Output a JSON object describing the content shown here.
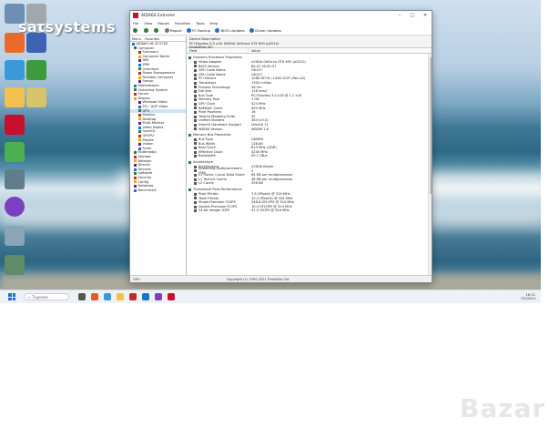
{
  "watermark": "satsystems",
  "bazar_logo": "Bazar",
  "window": {
    "title": "AIDA64 Extreme",
    "menu": [
      "File",
      "View",
      "Report",
      "Favorites",
      "Tools",
      "Help"
    ],
    "toolbar": [
      "Report",
      "PC Backup",
      "BIOS Updates",
      "Driver Updates"
    ],
    "left_tabs": [
      "Menu",
      "Favorites"
    ],
    "tree": [
      "AIDA64 v6.32.5700",
      "Computer",
      "Summary",
      "Computer Name",
      "DMI",
      "IPMI",
      "Overclock",
      "Power Management",
      "Portable Computer",
      "Sensor",
      "Motherboard",
      "Operating System",
      "Server",
      "Display",
      "Windows Video",
      "PCI / AGP Video",
      "GPU",
      "Monitor",
      "Desktop",
      "Multi-Monitor",
      "Video Modes",
      "OpenGL",
      "GPGPU",
      "Mantle",
      "Vulkan",
      "Fonts",
      "Multimedia",
      "Storage",
      "Network",
      "DirectX",
      "Devices",
      "Software",
      "Security",
      "Config",
      "Database",
      "Benchmark"
    ],
    "desc": {
      "label": "Device Description",
      "device": "PCI Express 3.0 x16: NVIDIA GeForce GTX 650 (p2010)",
      "extra": "NvidiaBios SEI"
    },
    "columns": {
      "field": "Field",
      "value": "Value"
    },
    "groups": [
      {
        "name": "Graphics Processor Properties",
        "rows": [
          [
            "Video Adapter",
            "nVIDIA GeForce GTX 650 (p2010)"
          ],
          [
            "BIOS Version",
            "80.07.35.00.57"
          ],
          [
            "GPU Code Name",
            "GK107"
          ],
          [
            "GPU Code Name",
            "GK107"
          ],
          [
            "PCI Device",
            "10DE-0FC6 / 1028-102F (Rev A2)"
          ],
          [
            "Transistors",
            "1300 million"
          ],
          [
            "Process Technology",
            "28 nm"
          ],
          [
            "Die Size",
            "118 mm2"
          ],
          [
            "Bus Type",
            "PCI Express 3.0 x16 @ 1.1 x16"
          ],
          [
            "Memory Size",
            "1 GB"
          ],
          [
            "GPU Clock",
            "324 MHz"
          ],
          [
            "RAMDAC Clock",
            "400 MHz"
          ],
          [
            "Pixel Pipelines",
            "16"
          ],
          [
            "Texture Mapping Units",
            "32"
          ],
          [
            "Unified Shaders",
            "384 (v5.0)"
          ],
          [
            "DirectX Hardware Support",
            "DirectX 11"
          ],
          [
            "WDDM Version",
            "WDDM 2.6"
          ]
        ]
      },
      {
        "name": "Memory Bus Properties",
        "rows": [
          [
            "Bus Type",
            "GDDR5"
          ],
          [
            "Bus Width",
            "128-bit"
          ],
          [
            "Real Clock",
            "810 MHz (QDR)"
          ],
          [
            "Effective Clock",
            "3240 MHz"
          ],
          [
            "Bandwidth",
            "50.1 GB/s"
          ]
        ]
      },
      {
        "name": "Architecture",
        "rows": [
          [
            "Architecture",
            "nVIDIA Kepler"
          ],
          [
            "Streaming Multiprocessors (SM)",
            "2"
          ],
          [
            "L1 Cache / Local Data Share",
            "64 KB per multiprocessor"
          ],
          [
            "L1 Texture Cache",
            "48 KB per multiprocessor"
          ],
          [
            "L2 Cache",
            "256 KB"
          ]
        ]
      },
      {
        "name": "Theoretical Peak Performance",
        "rows": [
          [
            "Pixel Fillrate",
            "7.6 GPixel/s @ 324 MHz"
          ],
          [
            "Texel Fillrate",
            "10.4 GTexel/s @ 324 MHz"
          ],
          [
            "Single-Precision FLOPS",
            "248.8 GFLOPS @ 324 MHz"
          ],
          [
            "Double-Precision FLOPS",
            "10.4 GFLOPS @ 324 MHz"
          ],
          [
            "24-bit Integer IOPS",
            "41.5 GIOPS @ 324 MHz"
          ]
        ]
      }
    ],
    "status_left": "GPU",
    "status_copy": "Copyright (c) 1995-2021 FinalWire Ltd."
  },
  "taskbar": {
    "search_placeholder": "Търсене",
    "time": "16:31",
    "date": "7/5/2024"
  },
  "desktop_icons": [
    "Кошче",
    "Стимул",
    "Skype"
  ],
  "colors": {
    "taskbar_bg": "#eef1f5",
    "accent": "#1f6fd1",
    "brand_red": "#c8102e"
  }
}
